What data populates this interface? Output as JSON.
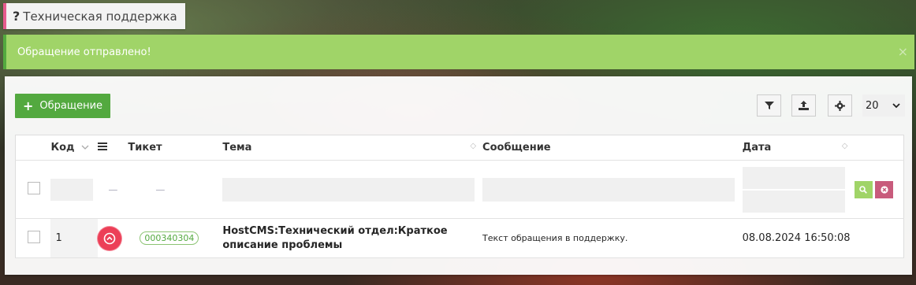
{
  "header": {
    "help_glyph": "?",
    "title": "Техническая поддержка"
  },
  "alert": {
    "message": "Обращение отправлено!",
    "close_glyph": "×"
  },
  "toolbar": {
    "add_label": "Обращение",
    "page_size": "20"
  },
  "columns": {
    "code": "Код",
    "ticket": "Тикет",
    "topic": "Тема",
    "message": "Сообщение",
    "date": "Дата"
  },
  "rows": [
    {
      "code": "1",
      "ticket": "000340304",
      "topic": "HostCMS:Технический отдел:Краткое описание проблемы",
      "message": "Текст обращения в поддержку.",
      "date": "08.08.2024 16:50:08"
    }
  ],
  "colors": {
    "accent_green": "#53a93f",
    "alert_green": "#a0d468",
    "status_red": "#ec3f57",
    "title_border": "#e75b8d"
  }
}
